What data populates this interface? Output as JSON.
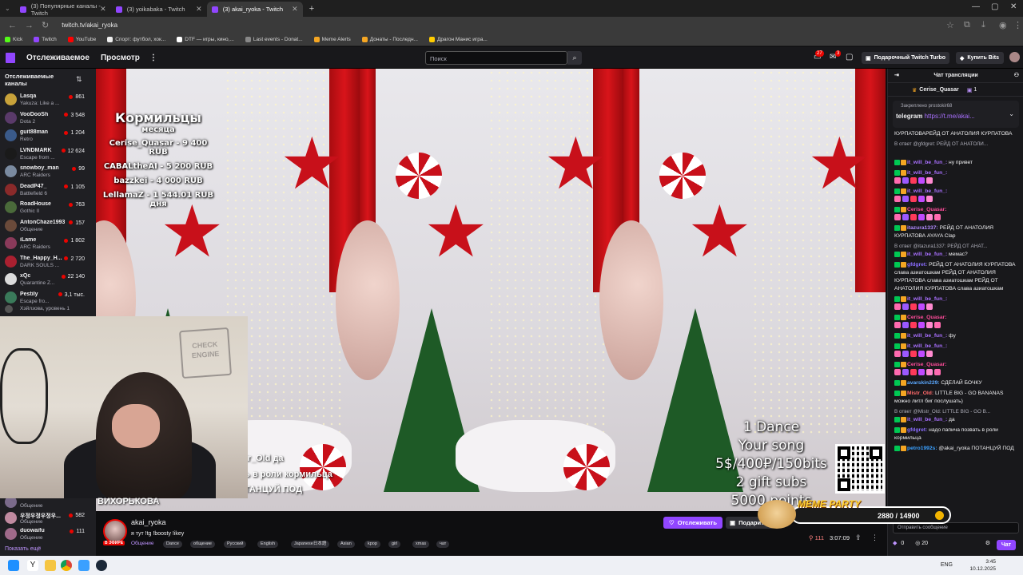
{
  "browser": {
    "tabs": [
      {
        "title": "(3) Популярные каналы - Twitch",
        "active": false
      },
      {
        "title": "(3) yoikabaka - Twitch",
        "active": false
      },
      {
        "title": "(3) akai_ryoka - Twitch",
        "active": true
      }
    ],
    "url": "twitch.tv/akai_ryoka",
    "bookmarks": [
      "Kick",
      "Twitch",
      "YouTube",
      "Спорт: футбол, хок...",
      "DTF — игры, кино,...",
      "Last events - Donat...",
      "Meme Alerts",
      "Донаты - Последн...",
      "Драгон Манис игра..."
    ]
  },
  "topnav": {
    "following": "Отслеживаемое",
    "browse": "Просмотр",
    "search_placeholder": "Поиск",
    "notif_count": "27",
    "inbox_count": "3",
    "turbo": "Подарочный Twitch Turbo",
    "bits": "Купить Bits"
  },
  "sidebar": {
    "title": "Отслеживаемые каналы",
    "channels": [
      {
        "name": "Lasqa",
        "game": "Yakuza: Like a ...",
        "viewers": "861",
        "color": "#c8a23a"
      },
      {
        "name": "VooDooSh",
        "game": "Dota 2",
        "viewers": "3 548",
        "color": "#5a3a6a"
      },
      {
        "name": "guit88man",
        "game": "Retro",
        "viewers": "1 204",
        "color": "#3a5a8a"
      },
      {
        "name": "LVNDMARK",
        "game": "Escape from ...",
        "viewers": "12 624",
        "color": "#1a1a1a"
      },
      {
        "name": "snowboy_man",
        "game": "ARC Raiders",
        "viewers": "99",
        "color": "#7a8aa0"
      },
      {
        "name": "DeadP47_",
        "game": "Battlefield 6",
        "viewers": "1 105",
        "color": "#8a2a2a"
      },
      {
        "name": "RoadHouse",
        "game": "Gothic II",
        "viewers": "763",
        "color": "#4a6a3a"
      },
      {
        "name": "AntonChaze1993",
        "game": "Общение",
        "viewers": "157",
        "color": "#6a4a3a"
      },
      {
        "name": "iLame",
        "game": "ARC Raiders",
        "viewers": "1 802",
        "color": "#8a3a5a"
      },
      {
        "name": "The_Happy_H...",
        "game": "DARK SOULS ...",
        "viewers": "2 720",
        "color": "#aa2030"
      },
      {
        "name": "xQc",
        "game": "Quarantine Z...",
        "viewers": "22 140",
        "color": "#dcdcdc"
      },
      {
        "name": "Pestily",
        "game": "Escape fro...",
        "viewers": "3,1 тыс.",
        "color": "#3a7a5a"
      }
    ],
    "hosting_note": "Хэйлзова, уровень 1",
    "lower_channels": [
      {
        "name": "",
        "game": "Общение",
        "viewers": "",
        "color": "#7a6a8a"
      },
      {
        "name": "우정우정우정우...",
        "game": "Общение",
        "viewers": "582",
        "color": "#c08aa0"
      },
      {
        "name": "duowaifu",
        "game": "Общение",
        "viewers": "111",
        "color": "#a06a8a"
      }
    ],
    "show_more": "Показать ещё"
  },
  "video": {
    "donors_title": "Кормильцы",
    "donors_subtitle": "месяца",
    "donors": [
      "Cerise_Quasar - 9 400 RUB",
      "CABALtheAI - 5 200 RUB",
      "bazzkei - 4 000 RUB",
      "LellamaZ - 1 544.01 RUB"
    ],
    "donors_day": "дня",
    "dance_text": [
      "1 Dance",
      "Your song",
      "5$/400₽/150bits",
      "2 gift subs",
      "5000 points"
    ],
    "webcam_sign": "CHECK ENGINE",
    "overlay_subs": [
      "tr_Old да",
      "ь в роли кормильца",
      "ТАНЦУЙ ПОД",
      "ВИХОРЬКОВА"
    ],
    "meme_label": "MEME PARTY",
    "meme_count": "2880 / 14900"
  },
  "stream": {
    "name": "akai_ryoka",
    "live": "В ЭФИРЕ",
    "title": "я тут !tg !boosty !ikey",
    "category": "Общение",
    "tags": [
      "Dance",
      "общение",
      "Русский",
      "English",
      "Japanese日本語",
      "Asian",
      "kpop",
      "girl",
      "xmas",
      "чат"
    ],
    "follow": "Отслеживать",
    "gift": "Подарить",
    "viewers": "111",
    "uptime": "3:07:09"
  },
  "chat": {
    "header": "Чат трансляции",
    "top_user": "Cerise_Quasar",
    "top_count": "1",
    "pinned_by": "Закреплено prostokir68",
    "pinned_text": "telegram",
    "pinned_link": "https://t.me/akai...",
    "messages": [
      {
        "user": "",
        "text": "КУРПАТОВАРЕЙД ОТ АНАТОЛИЯ КУРПАТОВА",
        "color": "#efeff1",
        "reply": ""
      },
      {
        "user": "",
        "text": "",
        "color": "#efeff1",
        "reply": "В ответ @gfdgret: РЕЙД ОТ АНАТОЛИ..."
      },
      {
        "user": "it_will_be_fun_:",
        "text": "ну привет",
        "color": "#a970ff",
        "reply": ""
      },
      {
        "user": "it_will_be_fun_:",
        "text": "",
        "color": "#a970ff",
        "reply": ""
      },
      {
        "user": "it_will_be_fun_:",
        "text": "",
        "color": "#a970ff",
        "reply": ""
      },
      {
        "user": "Cerise_Quasar:",
        "text": "",
        "color": "#ff4c9a",
        "reply": ""
      },
      {
        "user": "itazura1337:",
        "text": "РЕЙД ОТ АНАТОЛИЯ КУРПАТОВА AYAYA Clap",
        "color": "#b28aff",
        "reply": ""
      },
      {
        "user": "it_will_be_fun_:",
        "text": "мемас?",
        "color": "#a970ff",
        "reply": "В ответ @itazura1337: РЕЙД ОТ АНАТ..."
      },
      {
        "user": "gfdgret:",
        "text": "РЕЙД ОТ АНАТОЛИЯ КУРПАТОВА слава азиатошкам РЕЙД ОТ АНАТОЛИЯ КУРПАТОВА слава азиатошкам РЕЙД ОТ АНАТОЛИЯ КУРПАТОВА слава азиатошкам",
        "color": "#8a6cff",
        "reply": ""
      },
      {
        "user": "it_will_be_fun_:",
        "text": "",
        "color": "#a970ff",
        "reply": ""
      },
      {
        "user": "Cerise_Quasar:",
        "text": "",
        "color": "#ff4c9a",
        "reply": ""
      },
      {
        "user": "it_will_be_fun_:",
        "text": "фу",
        "color": "#a970ff",
        "reply": ""
      },
      {
        "user": "it_will_be_fun_:",
        "text": "",
        "color": "#a970ff",
        "reply": ""
      },
      {
        "user": "Cerise_Quasar:",
        "text": "",
        "color": "#ff4c9a",
        "reply": ""
      },
      {
        "user": "avarskin229:",
        "text": "СДЕЛАЙ БОЧКУ",
        "color": "#5aa8ff",
        "reply": ""
      },
      {
        "user": "Mistr_Old:",
        "text": "LITTLE BIG - GO BANANAS можно литл биг послушать)",
        "color": "#ff6a6a",
        "reply": ""
      },
      {
        "user": "it_will_be_fun_:",
        "text": "да",
        "color": "#a970ff",
        "reply": "В ответ @Mistr_Old: LITTLE BIG - GO B..."
      },
      {
        "user": "gfdgret:",
        "text": "надо папича позвать в роли кормильца",
        "color": "#8a6cff",
        "reply": ""
      },
      {
        "user": "petro1992s:",
        "text": "@akai_ryoka ПОТАНЦУЙ ПОД",
        "color": "#3aa0ff",
        "reply": ""
      }
    ],
    "input_placeholder": "Отправить сообщение",
    "points": "20",
    "chat_button": "Чат"
  },
  "taskbar": {
    "lang": "ENG",
    "time": "3:45",
    "date": "10.12.2025"
  }
}
